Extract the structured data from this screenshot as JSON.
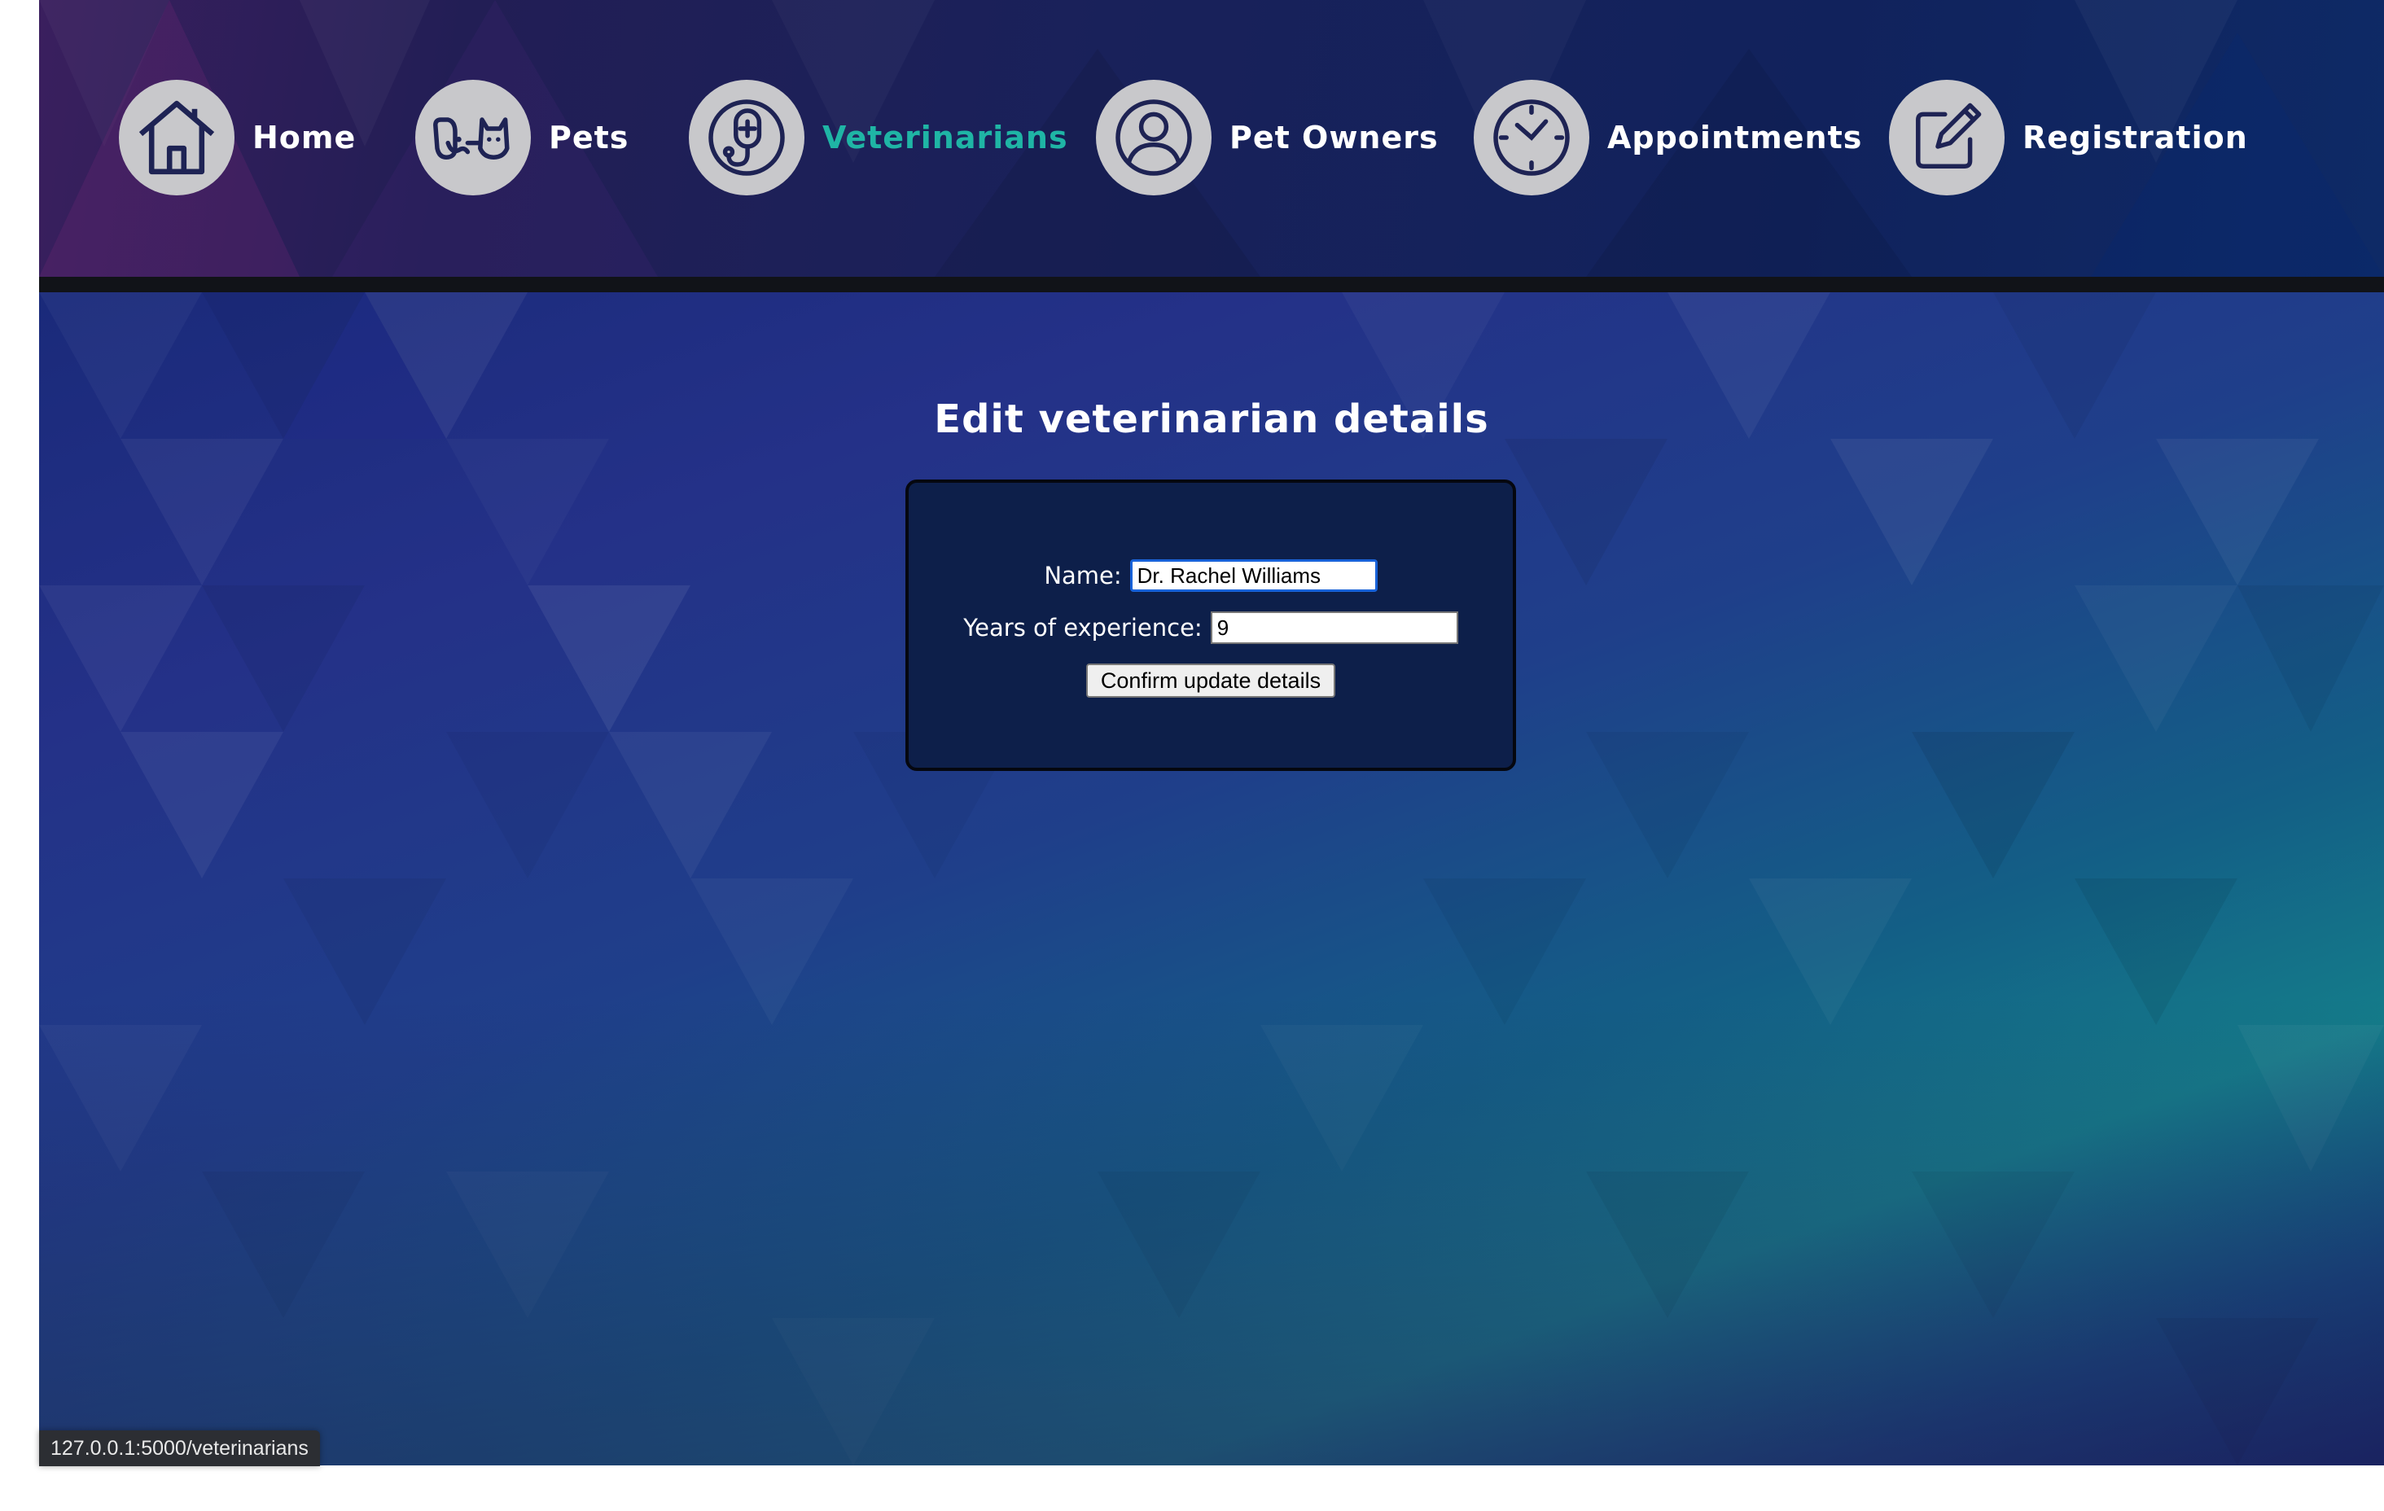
{
  "nav": {
    "items": [
      {
        "label": "Home",
        "icon": "house-icon",
        "active": false
      },
      {
        "label": "Pets",
        "icon": "dog-cat-icon",
        "active": false
      },
      {
        "label": "Veterinarians",
        "icon": "stethoscope-icon",
        "active": true
      },
      {
        "label": "Pet Owners",
        "icon": "person-icon",
        "active": false
      },
      {
        "label": "Appointments",
        "icon": "clock-icon",
        "active": false
      },
      {
        "label": "Registration",
        "icon": "edit-icon",
        "active": false
      }
    ],
    "active_color": "#1fb5a5"
  },
  "main": {
    "title": "Edit veterinarian details",
    "form": {
      "name_label": "Name:",
      "name_value": "Dr. Rachel Williams",
      "experience_label": "Years of experience:",
      "experience_value": "9",
      "confirm_label": "Confirm update details"
    }
  },
  "status_bar": {
    "url": "127.0.0.1:5000/veterinarians"
  }
}
